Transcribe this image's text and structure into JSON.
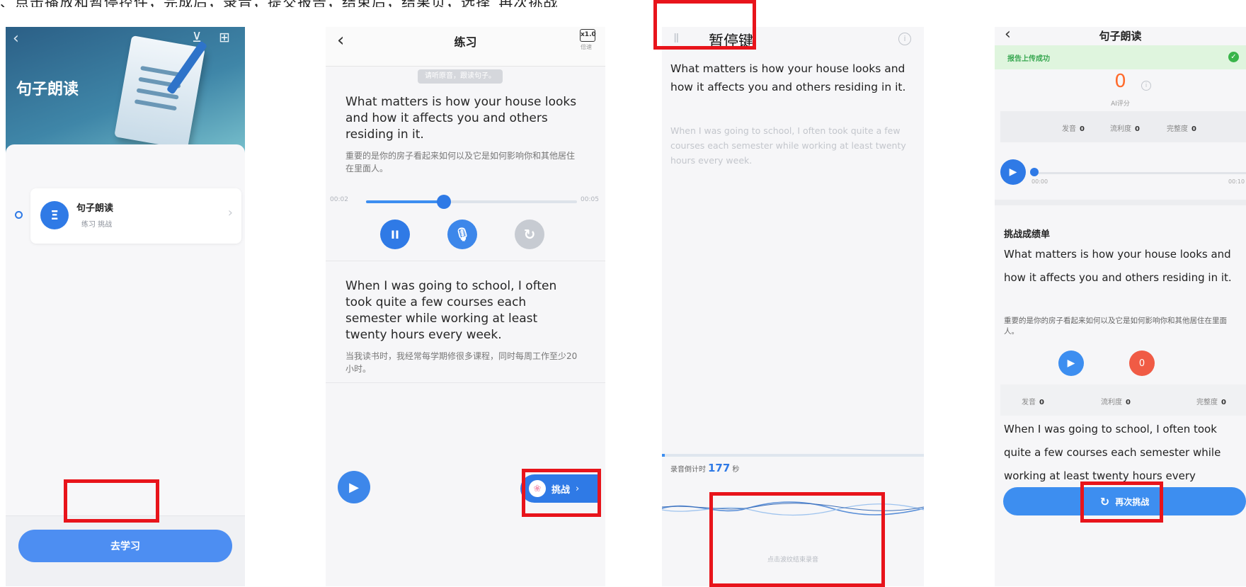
{
  "caption": "、点击播放和暂停控件，完成后，录音，提交报告，结束后，结果页，选择“再次挑战”",
  "screen1": {
    "back_icon": "‹",
    "tool_icons": "⊻ ⊞",
    "title": "句子朗读",
    "card": {
      "icon": "Ξ",
      "name": "句子朗读",
      "sub": "练习  挑战",
      "chevron": "›"
    },
    "button": "去学习"
  },
  "screen2": {
    "back_icon": "‹",
    "title": "练习",
    "speed_value": "x1.0",
    "speed_label": "倍速",
    "hint": "请听原音，跟读句子。",
    "sentence1_en": "What matters is how your house looks and how it affects you and others residing in it.",
    "sentence1_zh": "重要的是你的房子看起来如何以及它是如何影响你和其他居住在里面人。",
    "time_start": "00:02",
    "time_end": "00:05",
    "progress": 0.37,
    "pause_icon": "II",
    "mic_icon": "🎙",
    "replay_icon": "↻",
    "sentence2_en": "When I was going to school, I often took quite a few courses each semester while working at least twenty hours every week.",
    "sentence2_zh": "当我读书时，我经常每学期修很多课程，同时每周工作至少20小时。",
    "play_icon": "▶",
    "challenge_label": "挑战",
    "challenge_arrow": "›",
    "paw_icon": "❀"
  },
  "screen3": {
    "pause_icon": "II",
    "pause_label": "暂停键",
    "info_icon": "i",
    "sentence1_en": "What matters is how your house looks and how it affects you and others residing in it.",
    "sentence2_en": "When I was going to school, I often took quite a few courses each semester while working at least twenty hours every week.",
    "countdown_prefix": "录音倒计时",
    "countdown_value": "177",
    "countdown_unit": "秒",
    "end_hint": "点击波纹结束录音"
  },
  "screen4": {
    "back_icon": "‹",
    "title": "句子朗读",
    "success_text": "报告上传成功",
    "check_icon": "✓",
    "score": "0",
    "info_icon": "i",
    "ai_label": "AI评分",
    "metrics": [
      {
        "label": "发音",
        "value": "0"
      },
      {
        "label": "流利度",
        "value": "0"
      },
      {
        "label": "完整度",
        "value": "0"
      }
    ],
    "play_icon": "▶",
    "time_start": "00:00",
    "time_end": "00:10",
    "sheet_title": "挑战成绩单",
    "sentence1_en": "What matters is how your house looks and how it affects you and others residing in it.",
    "sentence1_zh": "重要的是你的房子看起来如何以及它是如何影响你和其他居住在里面人。",
    "sentence_score": "0",
    "sentence2_en": "When I was going to school, I often took quite a few courses each semester while working at least twenty hours every",
    "again_icon": "↻",
    "again_label": "再次挑战"
  }
}
